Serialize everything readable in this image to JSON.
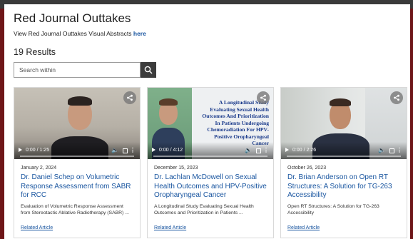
{
  "page": {
    "title": "Red Journal Outtakes",
    "visual_prefix": "View Red Journal Outtakes Visual Abstracts ",
    "visual_link": "here",
    "results": "19 Results"
  },
  "search": {
    "placeholder": "Search within",
    "value": ""
  },
  "cards": [
    {
      "time": "0:00 / 1:25",
      "date": "January 2, 2024",
      "title": "Dr. Daniel Schep on Volumetric Response Assessment from SABR for RCC",
      "desc": "Evaluation of Volumetric Response Assessment from Stereotactic Ablative Radiotherapy (SABR) ...",
      "related": "Related Article"
    },
    {
      "time": "0:00 / 4:12",
      "date": "December 15, 2023",
      "title": "Dr. Lachlan McDowell on Sexual Health Outcomes and HPV-Positive Oropharyngeal Cancer",
      "desc": "A Longitudinal Study Evaluating Sexual Health Outcomes and Prioritization in Patients ...",
      "related": "Related Article",
      "overlay": "A Longitudinal Study Evaluating Sexual Health Outcomes And Prioritization In Patients Undergoing Chemoradiation For HPV-Positive Oropharyngeal Cancer"
    },
    {
      "time": "0:00 / 2:26",
      "date": "October 26, 2023",
      "title": "Dr. Brian Anderson on Open RT Structures: A Solution for TG-263 Accessibility",
      "desc": "Open RT Structures: A Solution for TG-263 Accessibility",
      "related": "Related Article"
    }
  ],
  "icons": {
    "search": "search-icon",
    "share": "share-icon",
    "play": "play-icon",
    "volume": "volume-icon",
    "fullscreen": "fullscreen-icon",
    "more": "more-options-icon"
  },
  "colors": {
    "frame": "#6e1518",
    "link": "#1a56a0",
    "search_button": "#3c3c3c"
  }
}
